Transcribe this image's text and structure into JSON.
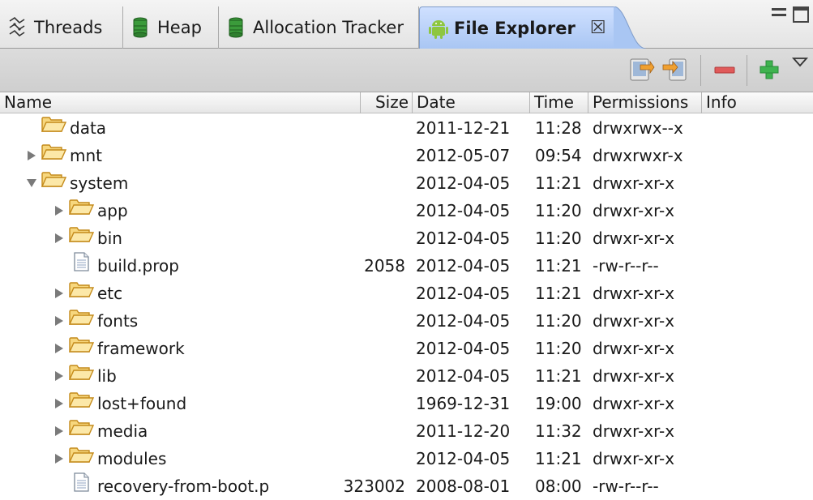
{
  "tabs": [
    {
      "label": "Threads",
      "icon": "threads-icon"
    },
    {
      "label": "Heap",
      "icon": "heap-icon"
    },
    {
      "label": "Allocation Tracker",
      "icon": "allocation-tracker-icon"
    },
    {
      "label": "File Explorer",
      "icon": "android-icon",
      "active": true
    }
  ],
  "toolbar": {
    "pull": "pull-file-icon",
    "push": "push-file-icon",
    "delete": "delete-icon",
    "new_folder": "new-folder-icon",
    "view_menu": "view-menu-icon"
  },
  "columns": {
    "name": "Name",
    "size": "Size",
    "date": "Date",
    "time": "Time",
    "permissions": "Permissions",
    "info": "Info"
  },
  "rows": [
    {
      "name": "data",
      "type": "folder",
      "level": 0,
      "expander": "none",
      "size": "",
      "date": "2011-12-21",
      "time": "11:28",
      "permissions": "drwxrwx--x"
    },
    {
      "name": "mnt",
      "type": "folder",
      "level": 0,
      "expander": "collapsed",
      "size": "",
      "date": "2012-05-07",
      "time": "09:54",
      "permissions": "drwxrwxr-x"
    },
    {
      "name": "system",
      "type": "folder",
      "level": 0,
      "expander": "expanded",
      "size": "",
      "date": "2012-04-05",
      "time": "11:21",
      "permissions": "drwxr-xr-x"
    },
    {
      "name": "app",
      "type": "folder",
      "level": 1,
      "expander": "collapsed",
      "size": "",
      "date": "2012-04-05",
      "time": "11:20",
      "permissions": "drwxr-xr-x"
    },
    {
      "name": "bin",
      "type": "folder",
      "level": 1,
      "expander": "collapsed",
      "size": "",
      "date": "2012-04-05",
      "time": "11:20",
      "permissions": "drwxr-xr-x"
    },
    {
      "name": "build.prop",
      "type": "file",
      "level": 1,
      "expander": "none",
      "size": "2058",
      "date": "2012-04-05",
      "time": "11:21",
      "permissions": "-rw-r--r--"
    },
    {
      "name": "etc",
      "type": "folder",
      "level": 1,
      "expander": "collapsed",
      "size": "",
      "date": "2012-04-05",
      "time": "11:21",
      "permissions": "drwxr-xr-x"
    },
    {
      "name": "fonts",
      "type": "folder",
      "level": 1,
      "expander": "collapsed",
      "size": "",
      "date": "2012-04-05",
      "time": "11:20",
      "permissions": "drwxr-xr-x"
    },
    {
      "name": "framework",
      "type": "folder",
      "level": 1,
      "expander": "collapsed",
      "size": "",
      "date": "2012-04-05",
      "time": "11:20",
      "permissions": "drwxr-xr-x"
    },
    {
      "name": "lib",
      "type": "folder",
      "level": 1,
      "expander": "collapsed",
      "size": "",
      "date": "2012-04-05",
      "time": "11:21",
      "permissions": "drwxr-xr-x"
    },
    {
      "name": "lost+found",
      "type": "folder",
      "level": 1,
      "expander": "collapsed",
      "size": "",
      "date": "1969-12-31",
      "time": "19:00",
      "permissions": "drwxr-xr-x"
    },
    {
      "name": "media",
      "type": "folder",
      "level": 1,
      "expander": "collapsed",
      "size": "",
      "date": "2011-12-20",
      "time": "11:32",
      "permissions": "drwxr-xr-x"
    },
    {
      "name": "modules",
      "type": "folder",
      "level": 1,
      "expander": "collapsed",
      "size": "",
      "date": "2012-04-05",
      "time": "11:21",
      "permissions": "drwxr-xr-x"
    },
    {
      "name": "recovery-from-boot.p",
      "type": "file",
      "level": 1,
      "expander": "none",
      "size": "323002",
      "date": "2008-08-01",
      "time": "08:00",
      "permissions": "-rw-r--r--"
    }
  ]
}
